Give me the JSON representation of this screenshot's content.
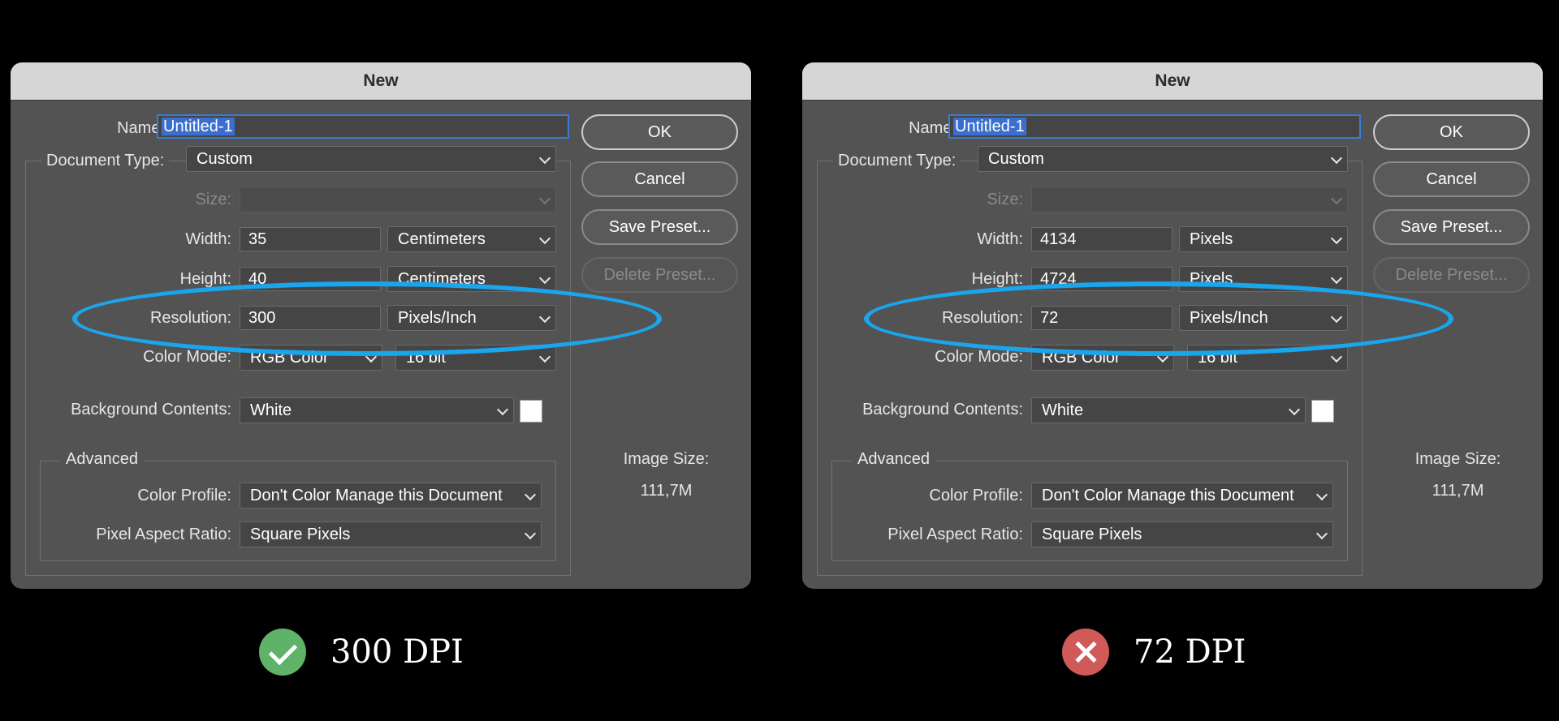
{
  "dialogs": [
    {
      "title": "New",
      "name_label": "Name:",
      "name_value": "Untitled-1",
      "doc_type_label": "Document Type:",
      "doc_type_value": "Custom",
      "size_label": "Size:",
      "width_label": "Width:",
      "width_value": "35",
      "width_unit": "Centimeters",
      "height_label": "Height:",
      "height_value": "40",
      "height_unit": "Centimeters",
      "resolution_label": "Resolution:",
      "resolution_value": "300",
      "resolution_unit": "Pixels/Inch",
      "color_mode_label": "Color Mode:",
      "color_mode_value": "RGB Color",
      "bit_depth_value": "16 bit",
      "bg_contents_label": "Background Contents:",
      "bg_contents_value": "White",
      "advanced_label": "Advanced",
      "color_profile_label": "Color Profile:",
      "color_profile_value": "Don't Color Manage this Document",
      "pixel_aspect_label": "Pixel Aspect Ratio:",
      "pixel_aspect_value": "Square Pixels",
      "ok_label": "OK",
      "cancel_label": "Cancel",
      "save_preset_label": "Save Preset...",
      "delete_preset_label": "Delete Preset...",
      "image_size_label": "Image Size:",
      "image_size_value": "111,7M"
    },
    {
      "title": "New",
      "name_label": "Name:",
      "name_value": "Untitled-1",
      "doc_type_label": "Document Type:",
      "doc_type_value": "Custom",
      "size_label": "Size:",
      "width_label": "Width:",
      "width_value": "4134",
      "width_unit": "Pixels",
      "height_label": "Height:",
      "height_value": "4724",
      "height_unit": "Pixels",
      "resolution_label": "Resolution:",
      "resolution_value": "72",
      "resolution_unit": "Pixels/Inch",
      "color_mode_label": "Color Mode:",
      "color_mode_value": "RGB Color",
      "bit_depth_value": "16 bit",
      "bg_contents_label": "Background Contents:",
      "bg_contents_value": "White",
      "advanced_label": "Advanced",
      "color_profile_label": "Color Profile:",
      "color_profile_value": "Don't Color Manage this Document",
      "pixel_aspect_label": "Pixel Aspect Ratio:",
      "pixel_aspect_value": "Square Pixels",
      "ok_label": "OK",
      "cancel_label": "Cancel",
      "save_preset_label": "Save Preset...",
      "delete_preset_label": "Delete Preset...",
      "image_size_label": "Image Size:",
      "image_size_value": "111,7M"
    }
  ],
  "captions": {
    "good": {
      "text": "300 DPI",
      "icon": "check-icon",
      "color": "#5fb368"
    },
    "bad": {
      "text": "72 DPI",
      "icon": "x-icon",
      "color": "#d05a58"
    }
  },
  "highlight_color": "#1aa5ec"
}
